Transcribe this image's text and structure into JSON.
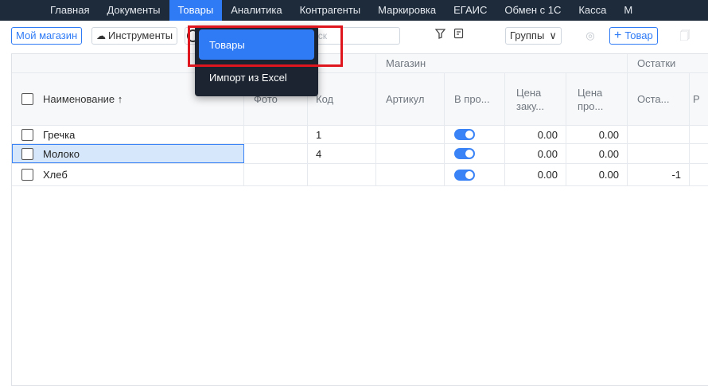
{
  "nav": [
    "Главная",
    "Документы",
    "Товары",
    "Аналитика",
    "Контрагенты",
    "Маркировка",
    "ЕГАИС",
    "Обмен с 1С",
    "Касса",
    "М"
  ],
  "nav_active": "Товары",
  "toolbar": {
    "my_shop": "Мой магазин",
    "tools": "Инструменты",
    "search_placeholder": "иск",
    "groups": "Группы",
    "add_product": "Товар"
  },
  "dropdown": {
    "items": [
      "Товары",
      "Импорт из Excel"
    ]
  },
  "table": {
    "groups": {
      "shop": "Магазин",
      "stock": "Остатки"
    },
    "columns": {
      "name": "Наименование ↑",
      "photo": "Фото",
      "code": "Код",
      "article": "Артикул",
      "on_sale": "В про...",
      "buy_price": "Цена заку...",
      "sell_price": "Цена про...",
      "stock": "Оста...",
      "extra": "Р"
    },
    "rows": [
      {
        "name": "Гречка",
        "code": "1",
        "buy": "0.00",
        "sell": "0.00",
        "stock": ""
      },
      {
        "name": "Молоко",
        "code": "4",
        "buy": "0.00",
        "sell": "0.00",
        "stock": ""
      },
      {
        "name": "Хлеб",
        "code": "",
        "buy": "0.00",
        "sell": "0.00",
        "stock": "-1"
      }
    ]
  }
}
